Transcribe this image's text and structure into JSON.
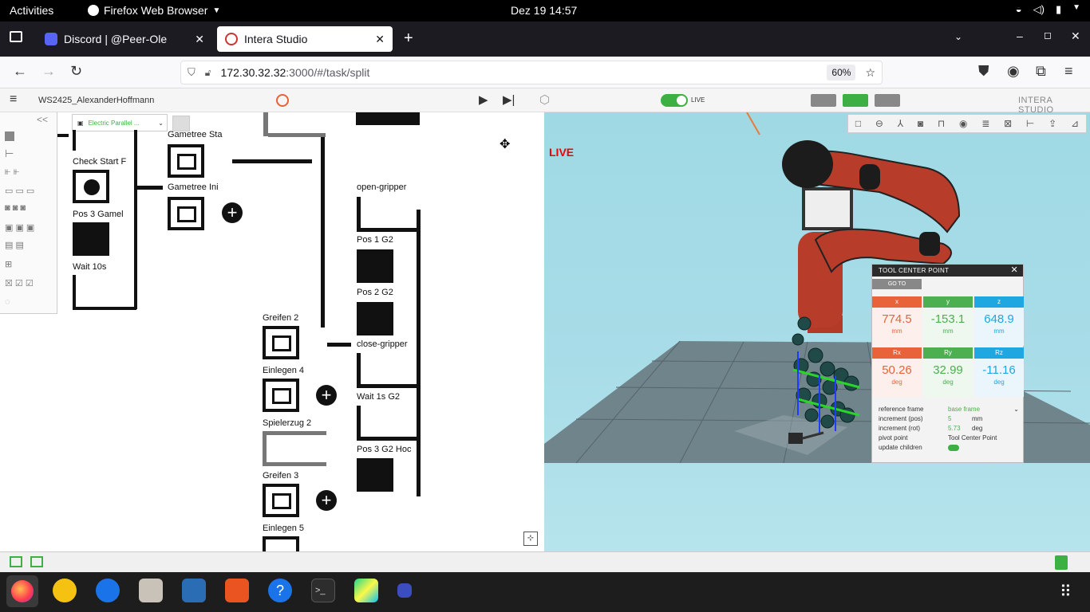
{
  "topbar": {
    "activities": "Activities",
    "app": "Firefox Web Browser",
    "clock": "Dez 19  14:57"
  },
  "tabs": [
    {
      "title": "Discord | @Peer-Ole"
    },
    {
      "title": "Intera Studio"
    }
  ],
  "navbar": {
    "url_host": "172.30.32.32",
    "url_rest": ":3000/#/task/split",
    "zoom": "60%"
  },
  "app": {
    "project": "WS2425_AlexanderHoffmann",
    "live_label": "LIVE",
    "brand": "INTERA STUDIO",
    "palette_collapse": "<<",
    "device_selector": "Electric Parallel ..."
  },
  "canvas": {
    "nodes": {
      "check_start": "Check Start F",
      "pos3_gamel": "Pos 3 Gamel",
      "wait10": "Wait 10s",
      "gametree_sta": "Gametree Sta",
      "gametree_ini": "Gametree Ini",
      "greifen2": "Greifen 2",
      "einlegen4": "Einlegen 4",
      "spielerzug2": "Spielerzug 2",
      "greifen3": "Greifen 3",
      "einlegen5": "Einlegen 5",
      "open_gripper": "open-gripper",
      "pos1g2": "Pos 1 G2",
      "pos2g2": "Pos 2 G2",
      "close_gripper": "close-gripper",
      "wait1s": "Wait 1s G2",
      "pos3g2hoc": "Pos 3 G2 Hoc"
    }
  },
  "viewport": {
    "live": "LIVE"
  },
  "tcp": {
    "title": "TOOL CENTER POINT",
    "goto": "GO TO",
    "cells": [
      {
        "axis": "x",
        "value": "774.5",
        "unit": "mm",
        "color": "#e8623a"
      },
      {
        "axis": "y",
        "value": "-153.1",
        "unit": "mm",
        "color": "#4caf50"
      },
      {
        "axis": "z",
        "value": "648.9",
        "unit": "mm",
        "color": "#1ea7e1"
      },
      {
        "axis": "Rx",
        "value": "50.26",
        "unit": "deg",
        "color": "#e8623a"
      },
      {
        "axis": "Ry",
        "value": "32.99",
        "unit": "deg",
        "color": "#4caf50"
      },
      {
        "axis": "Rz",
        "value": "-11.16",
        "unit": "deg",
        "color": "#1ea7e1"
      }
    ],
    "settings": {
      "ref_frame_label": "reference frame",
      "ref_frame_value": "base frame",
      "inc_pos_label": "increment (pos)",
      "inc_pos_value": "5",
      "inc_pos_unit": "mm",
      "inc_rot_label": "increment (rot)",
      "inc_rot_value": "5.73",
      "inc_rot_unit": "deg",
      "pivot_label": "pivot point",
      "pivot_value": "Tool Center Point",
      "update_label": "update children"
    }
  }
}
